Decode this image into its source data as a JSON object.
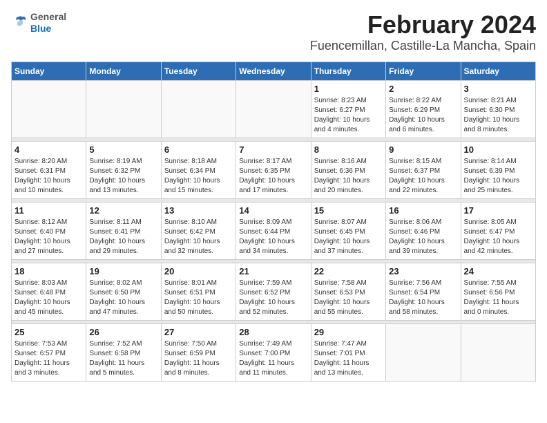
{
  "header": {
    "logo_general": "General",
    "logo_blue": "Blue",
    "month_title": "February 2024",
    "location": "Fuencemillan, Castille-La Mancha, Spain"
  },
  "weekdays": [
    "Sunday",
    "Monday",
    "Tuesday",
    "Wednesday",
    "Thursday",
    "Friday",
    "Saturday"
  ],
  "weeks": [
    [
      {
        "day": "",
        "info": ""
      },
      {
        "day": "",
        "info": ""
      },
      {
        "day": "",
        "info": ""
      },
      {
        "day": "",
        "info": ""
      },
      {
        "day": "1",
        "info": "Sunrise: 8:23 AM\nSunset: 6:27 PM\nDaylight: 10 hours\nand 4 minutes."
      },
      {
        "day": "2",
        "info": "Sunrise: 8:22 AM\nSunset: 6:29 PM\nDaylight: 10 hours\nand 6 minutes."
      },
      {
        "day": "3",
        "info": "Sunrise: 8:21 AM\nSunset: 6:30 PM\nDaylight: 10 hours\nand 8 minutes."
      }
    ],
    [
      {
        "day": "4",
        "info": "Sunrise: 8:20 AM\nSunset: 6:31 PM\nDaylight: 10 hours\nand 10 minutes."
      },
      {
        "day": "5",
        "info": "Sunrise: 8:19 AM\nSunset: 6:32 PM\nDaylight: 10 hours\nand 13 minutes."
      },
      {
        "day": "6",
        "info": "Sunrise: 8:18 AM\nSunset: 6:34 PM\nDaylight: 10 hours\nand 15 minutes."
      },
      {
        "day": "7",
        "info": "Sunrise: 8:17 AM\nSunset: 6:35 PM\nDaylight: 10 hours\nand 17 minutes."
      },
      {
        "day": "8",
        "info": "Sunrise: 8:16 AM\nSunset: 6:36 PM\nDaylight: 10 hours\nand 20 minutes."
      },
      {
        "day": "9",
        "info": "Sunrise: 8:15 AM\nSunset: 6:37 PM\nDaylight: 10 hours\nand 22 minutes."
      },
      {
        "day": "10",
        "info": "Sunrise: 8:14 AM\nSunset: 6:39 PM\nDaylight: 10 hours\nand 25 minutes."
      }
    ],
    [
      {
        "day": "11",
        "info": "Sunrise: 8:12 AM\nSunset: 6:40 PM\nDaylight: 10 hours\nand 27 minutes."
      },
      {
        "day": "12",
        "info": "Sunrise: 8:11 AM\nSunset: 6:41 PM\nDaylight: 10 hours\nand 29 minutes."
      },
      {
        "day": "13",
        "info": "Sunrise: 8:10 AM\nSunset: 6:42 PM\nDaylight: 10 hours\nand 32 minutes."
      },
      {
        "day": "14",
        "info": "Sunrise: 8:09 AM\nSunset: 6:44 PM\nDaylight: 10 hours\nand 34 minutes."
      },
      {
        "day": "15",
        "info": "Sunrise: 8:07 AM\nSunset: 6:45 PM\nDaylight: 10 hours\nand 37 minutes."
      },
      {
        "day": "16",
        "info": "Sunrise: 8:06 AM\nSunset: 6:46 PM\nDaylight: 10 hours\nand 39 minutes."
      },
      {
        "day": "17",
        "info": "Sunrise: 8:05 AM\nSunset: 6:47 PM\nDaylight: 10 hours\nand 42 minutes."
      }
    ],
    [
      {
        "day": "18",
        "info": "Sunrise: 8:03 AM\nSunset: 6:48 PM\nDaylight: 10 hours\nand 45 minutes."
      },
      {
        "day": "19",
        "info": "Sunrise: 8:02 AM\nSunset: 6:50 PM\nDaylight: 10 hours\nand 47 minutes."
      },
      {
        "day": "20",
        "info": "Sunrise: 8:01 AM\nSunset: 6:51 PM\nDaylight: 10 hours\nand 50 minutes."
      },
      {
        "day": "21",
        "info": "Sunrise: 7:59 AM\nSunset: 6:52 PM\nDaylight: 10 hours\nand 52 minutes."
      },
      {
        "day": "22",
        "info": "Sunrise: 7:58 AM\nSunset: 6:53 PM\nDaylight: 10 hours\nand 55 minutes."
      },
      {
        "day": "23",
        "info": "Sunrise: 7:56 AM\nSunset: 6:54 PM\nDaylight: 10 hours\nand 58 minutes."
      },
      {
        "day": "24",
        "info": "Sunrise: 7:55 AM\nSunset: 6:56 PM\nDaylight: 11 hours\nand 0 minutes."
      }
    ],
    [
      {
        "day": "25",
        "info": "Sunrise: 7:53 AM\nSunset: 6:57 PM\nDaylight: 11 hours\nand 3 minutes."
      },
      {
        "day": "26",
        "info": "Sunrise: 7:52 AM\nSunset: 6:58 PM\nDaylight: 11 hours\nand 5 minutes."
      },
      {
        "day": "27",
        "info": "Sunrise: 7:50 AM\nSunset: 6:59 PM\nDaylight: 11 hours\nand 8 minutes."
      },
      {
        "day": "28",
        "info": "Sunrise: 7:49 AM\nSunset: 7:00 PM\nDaylight: 11 hours\nand 11 minutes."
      },
      {
        "day": "29",
        "info": "Sunrise: 7:47 AM\nSunset: 7:01 PM\nDaylight: 11 hours\nand 13 minutes."
      },
      {
        "day": "",
        "info": ""
      },
      {
        "day": "",
        "info": ""
      }
    ]
  ]
}
